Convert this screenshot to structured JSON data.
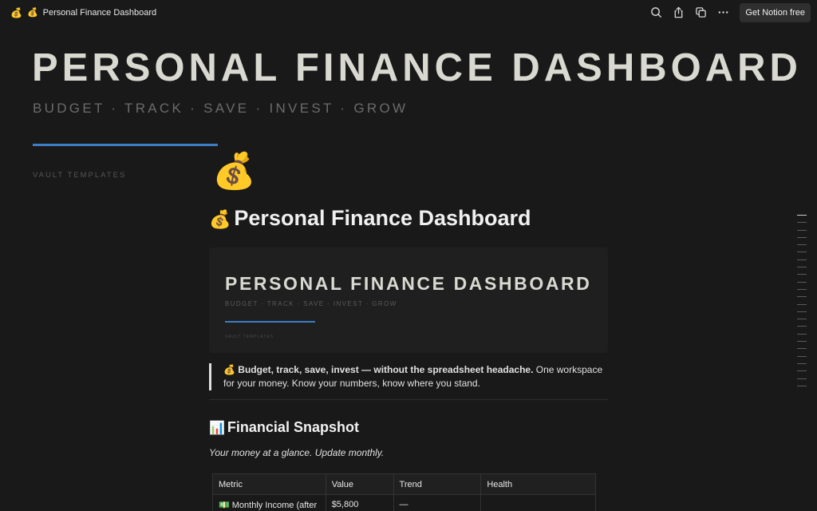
{
  "topbar": {
    "crumb_icon": "💰",
    "crumb_icon2": "💰",
    "title": "Personal Finance Dashboard",
    "icons": [
      "search-icon",
      "share-icon",
      "duplicate-icon",
      "more-icon"
    ],
    "cta": "Get Notion free"
  },
  "cover": {
    "title": "PERSONAL FINANCE DASHBOARD",
    "subtitle": "BUDGET · TRACK · SAVE · INVEST · GROW",
    "vault": "VAULT TEMPLATES",
    "accent": "#3d7dc4"
  },
  "page": {
    "icon": "💰",
    "title_emoji": "💰",
    "title": "Personal Finance Dashboard"
  },
  "banner": {
    "title": "PERSONAL FINANCE DASHBOARD",
    "subtitle": "BUDGET · TRACK · SAVE · INVEST · GROW",
    "vault": "VAULT TEMPLATES"
  },
  "quote": {
    "emoji": "💰",
    "bold": "Budget, track, save, invest — without the spreadsheet headache.",
    "rest": "One workspace for your money. Know your numbers, know where you stand."
  },
  "snapshot": {
    "emoji": "📊",
    "heading": "Financial Snapshot",
    "note": "Your money at a glance. Update monthly.",
    "columns": [
      "Metric",
      "Value",
      "Trend",
      "Health"
    ],
    "rows": [
      {
        "emoji": "💵",
        "metric": "Monthly Income (after",
        "value": "$5,800",
        "trend": "—",
        "health": ""
      }
    ]
  },
  "toc": {
    "count": 24,
    "active_index": 0
  }
}
